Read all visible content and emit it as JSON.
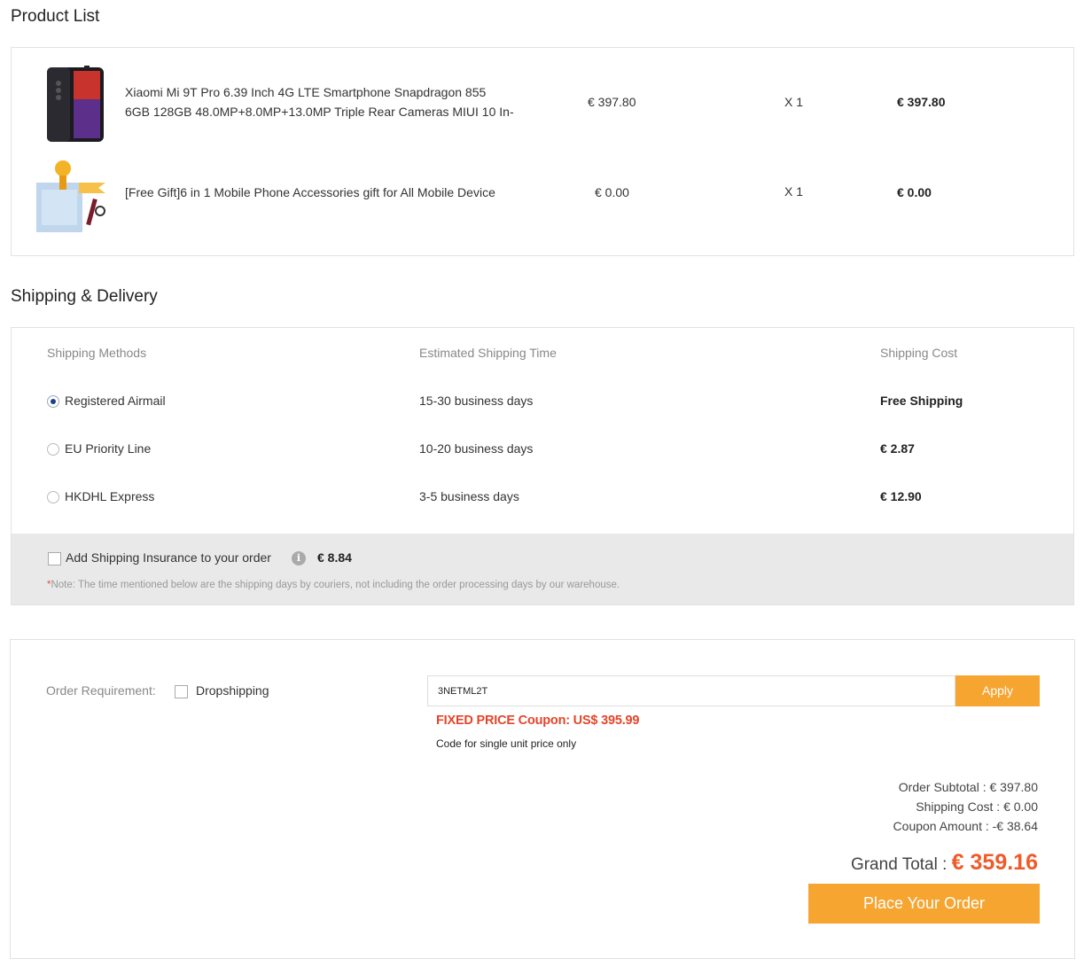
{
  "product_list": {
    "title": "Product List",
    "items": [
      {
        "name_line1": "Xiaomi Mi 9T Pro 6.39 Inch 4G LTE Smartphone Snapdragon 855",
        "name_line2": "6GB 128GB 48.0MP+8.0MP+13.0MP Triple Rear Cameras MIUI 10 In-",
        "price": "€ 397.80",
        "quantity": "X 1",
        "total": "€ 397.80"
      },
      {
        "name_line1": "[Free Gift]6 in 1 Mobile Phone Accessories gift for All Mobile Device",
        "price": "€ 0.00",
        "quantity": "X 1",
        "total": "€ 0.00"
      }
    ]
  },
  "shipping": {
    "title": "Shipping & Delivery",
    "headers": {
      "method": "Shipping Methods",
      "time": "Estimated Shipping Time",
      "cost": "Shipping Cost"
    },
    "options": [
      {
        "name": "Registered Airmail",
        "time": "15-30 business days",
        "cost": "Free Shipping",
        "selected": true
      },
      {
        "name": "EU Priority Line",
        "time": "10-20 business days",
        "cost": "€ 2.87",
        "selected": false
      },
      {
        "name": "HKDHL Express",
        "time": "3-5 business days",
        "cost": "€ 12.90",
        "selected": false
      }
    ],
    "insurance": {
      "label": "Add Shipping Insurance to your order",
      "info_icon": "i",
      "price": "€ 8.84",
      "checked": false
    },
    "note_star": "*",
    "note": "Note: The time mentioned below are the shipping days by couriers, not including the order processing days by our warehouse."
  },
  "order": {
    "requirement_label": "Order Requirement:",
    "dropshipping_label": "Dropshipping",
    "coupon_code": "3NETML2T",
    "apply_label": "Apply",
    "coupon_message": "FIXED PRICE Coupon: US$ 395.99",
    "coupon_note": "Code for single unit price only",
    "subtotal": "Order Subtotal : € 397.80",
    "shipping_cost": "Shipping Cost : € 0.00",
    "coupon_amount": "Coupon Amount : -€ 38.64",
    "grand_total_label": "Grand Total : ",
    "grand_total_value": "€ 359.16",
    "place_order_label": "Place Your Order"
  },
  "colors": {
    "accent_orange": "#f6a531",
    "price_red": "#ef5a29",
    "coupon_red": "#e5452a",
    "radio_selected": "#1f3f8f"
  }
}
